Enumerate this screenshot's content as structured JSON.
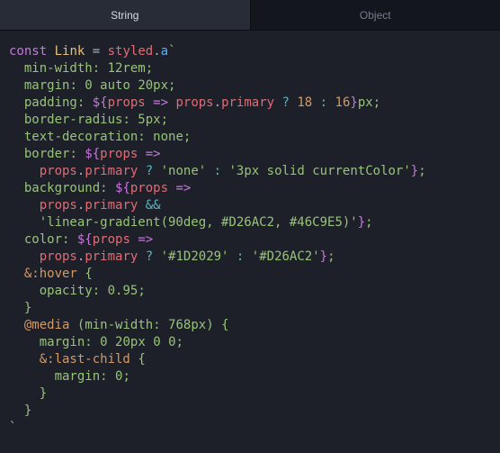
{
  "tabs": {
    "string": "String",
    "object": "Object"
  },
  "code": {
    "l0": {
      "const": "const",
      "Link": "Link",
      "eq": " = ",
      "styled": "styled",
      "dot": ".",
      "a": "a",
      "bt": "`"
    },
    "l1": {
      "prop": "min-width",
      "colon": ": ",
      "val": "12rem",
      "semi": ";"
    },
    "l2": {
      "prop": "margin",
      "colon": ": ",
      "v1": "0",
      "sp": " ",
      "v2": "auto",
      "sp2": " ",
      "v3": "20px",
      "semi": ";"
    },
    "l3": {
      "prop": "padding",
      "colon": ": ",
      "iopen": "${",
      "props": "props",
      "arrow": " => ",
      "props2": "props",
      "dot": ".",
      "primary": "primary",
      "q": " ? ",
      "n1": "18",
      "c": " : ",
      "n2": "16",
      "iclose": "}",
      "unit": "px",
      "semi": ";"
    },
    "l4": {
      "prop": "border-radius",
      "colon": ": ",
      "val": "5px",
      "semi": ";"
    },
    "l5": {
      "prop": "text-decoration",
      "colon": ": ",
      "val": "none",
      "semi": ";"
    },
    "l6": {
      "prop": "border",
      "colon": ": ",
      "iopen": "${",
      "props": "props",
      "arrow": " =>"
    },
    "l7": {
      "props": "props",
      "dot": ".",
      "primary": "primary",
      "q": " ? ",
      "s1": "'none'",
      "c": " : ",
      "s2": "'3px solid currentColor'",
      "iclose": "}",
      "semi": ";"
    },
    "l8": {
      "prop": "background",
      "colon": ": ",
      "iopen": "${",
      "props": "props",
      "arrow": " =>"
    },
    "l9": {
      "props": "props",
      "dot": ".",
      "primary": "primary",
      "and": " &&"
    },
    "l10": {
      "s": "'linear-gradient(90deg, #D26AC2, #46C9E5)'",
      "iclose": "}",
      "semi": ";"
    },
    "l11": {
      "prop": "color",
      "colon": ": ",
      "iopen": "${",
      "props": "props",
      "arrow": " =>"
    },
    "l12": {
      "props": "props",
      "dot": ".",
      "primary": "primary",
      "q": " ? ",
      "s1": "'#1D2029'",
      "c": " : ",
      "s2": "'#D26AC2'",
      "iclose": "}",
      "semi": ";"
    },
    "l13": {
      "sel": "&:hover",
      "sp": " ",
      "brace": "{"
    },
    "l14": {
      "prop": "opacity",
      "colon": ": ",
      "val": "0.95",
      "semi": ";"
    },
    "l15": {
      "brace": "}"
    },
    "l16": {
      "at": "@media",
      "sp": " ",
      "paren": "(",
      "feat": "min-width",
      "colon": ": ",
      "val": "768px",
      "paren2": ")",
      "sp2": " ",
      "brace": "{"
    },
    "l17": {
      "prop": "margin",
      "colon": ": ",
      "v1": "0",
      "sp": " ",
      "v2": "20px",
      "sp2": " ",
      "v3": "0",
      "sp3": " ",
      "v4": "0",
      "semi": ";"
    },
    "l18": {
      "sel": "&:last-child",
      "sp": " ",
      "brace": "{"
    },
    "l19": {
      "prop": "margin",
      "colon": ": ",
      "val": "0",
      "semi": ";"
    },
    "l20": {
      "brace": "}"
    },
    "l21": {
      "brace": "}"
    },
    "l22": {
      "bt": "`"
    }
  }
}
